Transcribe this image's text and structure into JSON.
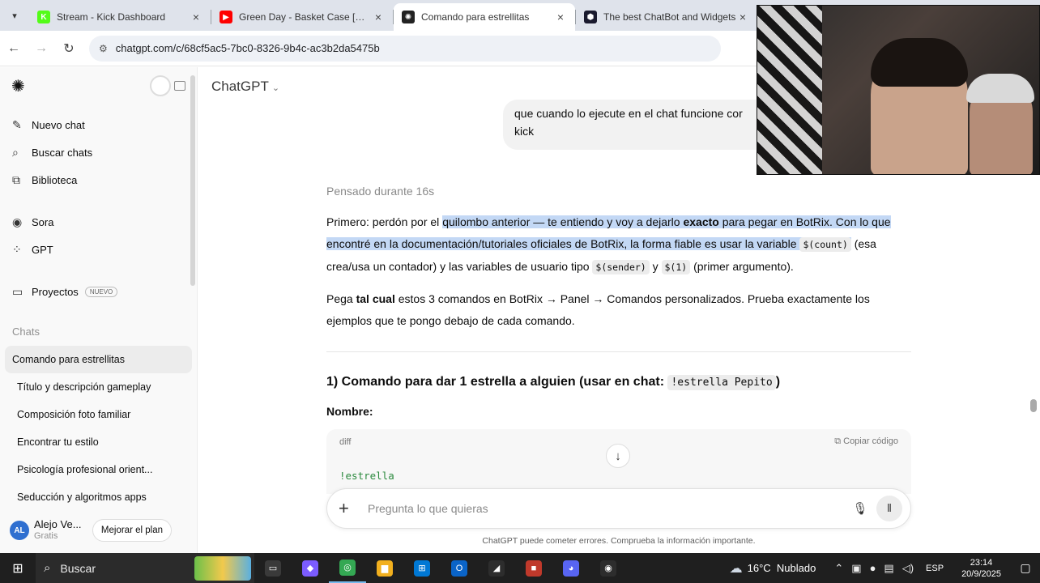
{
  "browser": {
    "tabs": [
      {
        "title": "Stream - Kick Dashboard",
        "favicon_color": "#53fc18",
        "favicon_glyph": "K",
        "active": false
      },
      {
        "title": "Green Day - Basket Case [Official",
        "favicon_color": "#ff0000",
        "favicon_glyph": "▶",
        "active": false
      },
      {
        "title": "Comando para estrellitas",
        "favicon_color": "#222222",
        "favicon_glyph": "✺",
        "active": true
      },
      {
        "title": "The best ChatBot and Widgets",
        "favicon_color": "#1a1a2e",
        "favicon_glyph": "⬢",
        "active": false
      }
    ],
    "url": "chatgpt.com/c/68cf5ac5-7bc0-8326-9b4c-ac3b2da5475b"
  },
  "sidebar": {
    "nav": [
      {
        "label": "Nuevo chat",
        "icon": "✎"
      },
      {
        "label": "Buscar chats",
        "icon": "⌕"
      },
      {
        "label": "Biblioteca",
        "icon": "⧉"
      }
    ],
    "nav2": [
      {
        "label": "Sora",
        "icon": "◉"
      },
      {
        "label": "GPT",
        "icon": "⁘"
      }
    ],
    "projects_label": "Proyectos",
    "new_badge": "NUEVO",
    "chats_heading": "Chats",
    "chats": [
      "Comando para estrellitas",
      "Título y descripción gameplay",
      "Composición foto familiar",
      "Encontrar tu estilo",
      "Psicología profesional orient...",
      "Seducción y algoritmos apps"
    ],
    "user": {
      "initials": "AL",
      "name": "Alejo Ve...",
      "plan": "Gratis",
      "upgrade": "Mejorar el plan"
    }
  },
  "main": {
    "model": "ChatGPT",
    "user_message_tail": "que cuando lo ejecute en el chat funcione cor",
    "user_message_tail2": "kick",
    "thought": "Pensado durante 16s",
    "p1": {
      "a": "Primero: perdón por el ",
      "b": "quilombo anterior — te entiendo y voy a dejarlo ",
      "c": "exacto",
      "d": " para pegar en BotRix. Con lo que encontré en la documentación/tutoriales oficiales de BotRix, la forma fiable es usar la variable ",
      "code1": "$(count)",
      "e": " (esa crea/usa un contador) y las variables de usuario tipo ",
      "code2": "$(sender)",
      "f": " y ",
      "code3": "$(1)",
      "g": " (primer argumento)."
    },
    "p2": {
      "a": "Pega ",
      "b": "tal cual",
      "c": " estos 3 comandos en BotRix → Panel → Comandos personalizados. Prueba exactamente los ejemplos que te pongo debajo de cada comando."
    },
    "heading": {
      "a": "1) Comando para dar 1 estrella a alguien (usar en chat: ",
      "code": "!estrella Pepito",
      "b": ")"
    },
    "name_label": "Nombre:",
    "code_lang": "diff",
    "copy_label": "Copiar código",
    "code_line": "!estrella",
    "composer_placeholder": "Pregunta lo que quieras",
    "disclaimer": "ChatGPT puede cometer errores. Comprueba la información importante."
  },
  "taskbar": {
    "search": "Buscar",
    "apps": [
      {
        "name": "task-view",
        "color": "#3a3a3a",
        "glyph": "▭"
      },
      {
        "name": "copilot",
        "color": "#7b5cff",
        "glyph": "◆"
      },
      {
        "name": "chrome",
        "color": "#34a853",
        "glyph": "◎"
      },
      {
        "name": "file-explorer",
        "color": "#f2b01e",
        "glyph": "▆"
      },
      {
        "name": "store",
        "color": "#0078d4",
        "glyph": "⊞"
      },
      {
        "name": "outlook",
        "color": "#0a64c8",
        "glyph": "O"
      },
      {
        "name": "app-7",
        "color": "#2d2d2d",
        "glyph": "◢"
      },
      {
        "name": "app-8",
        "color": "#c0392b",
        "glyph": "■"
      },
      {
        "name": "discord",
        "color": "#5865f2",
        "glyph": "◕"
      },
      {
        "name": "app-10",
        "color": "#2d2d2d",
        "glyph": "◉"
      }
    ],
    "weather_temp": "16°C",
    "weather_desc": "Nublado",
    "lang": "ESP",
    "time": "23:14",
    "date": "20/9/2025"
  }
}
